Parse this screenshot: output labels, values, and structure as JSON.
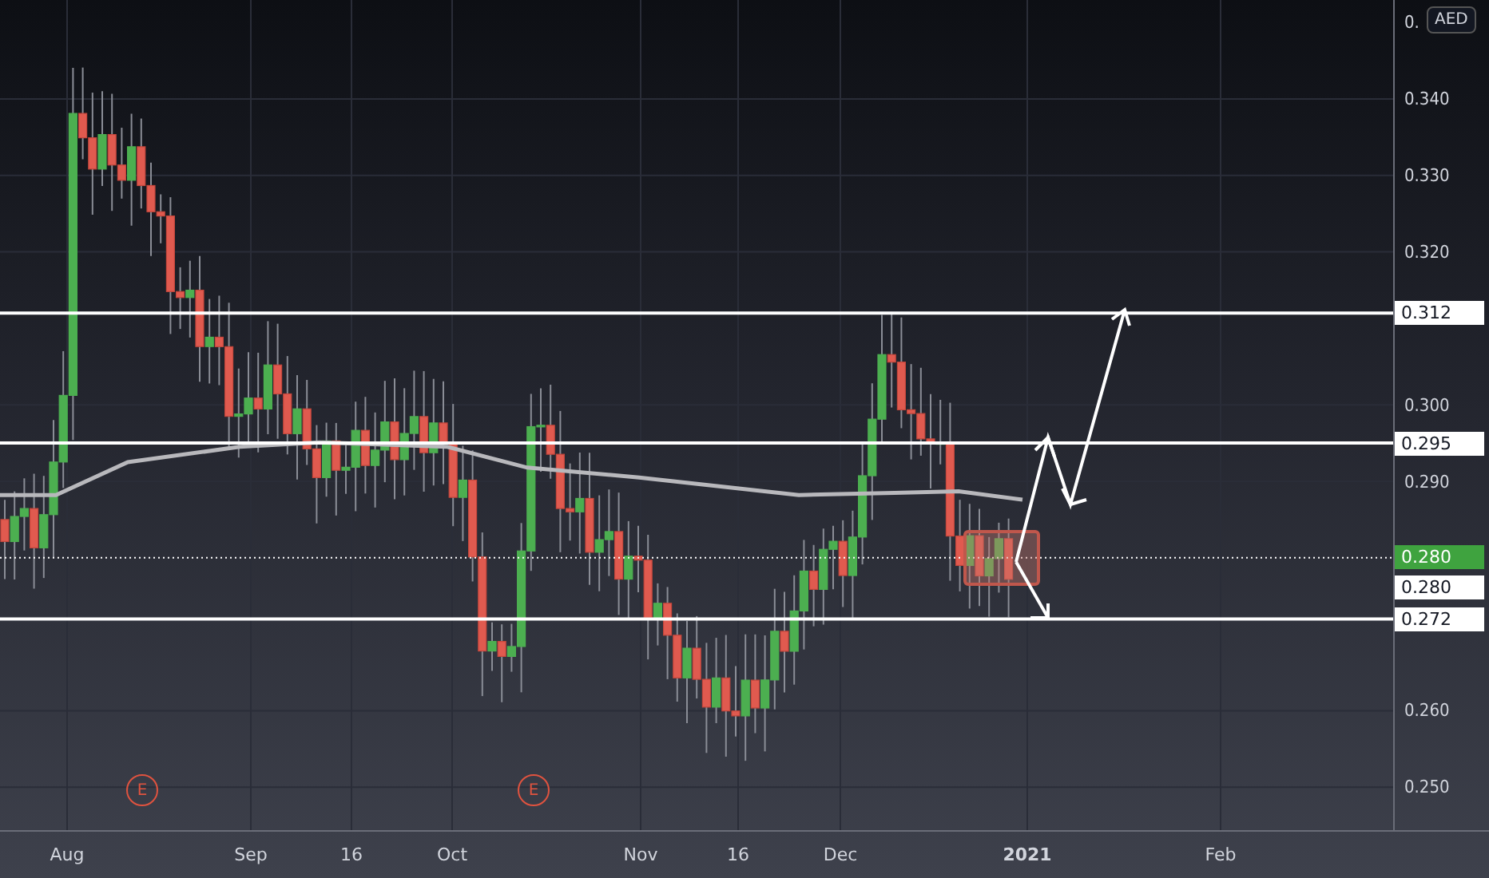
{
  "price_axis": {
    "top_label": "0.",
    "currency_button": "AED",
    "ticks": [
      "0.340",
      "0.330",
      "0.320",
      "0.300",
      "0.290",
      "0.260",
      "0.250"
    ]
  },
  "levels": [
    {
      "label": "0.312",
      "kind": "line"
    },
    {
      "label": "0.295",
      "kind": "line"
    },
    {
      "label": "0.280",
      "kind": "current"
    },
    {
      "label": "0.280",
      "kind": "plain"
    },
    {
      "label": "0.272",
      "kind": "line"
    }
  ],
  "events": [
    {
      "label": "E"
    },
    {
      "label": "E"
    }
  ],
  "time_axis": [
    {
      "label": "Aug",
      "kind": "month"
    },
    {
      "label": "Sep",
      "kind": "month"
    },
    {
      "label": "16",
      "kind": "day"
    },
    {
      "label": "Oct",
      "kind": "month"
    },
    {
      "label": "Nov",
      "kind": "month"
    },
    {
      "label": "16",
      "kind": "day"
    },
    {
      "label": "Dec",
      "kind": "month"
    },
    {
      "label": "2021",
      "kind": "year"
    },
    {
      "label": "Feb",
      "kind": "month"
    }
  ]
}
